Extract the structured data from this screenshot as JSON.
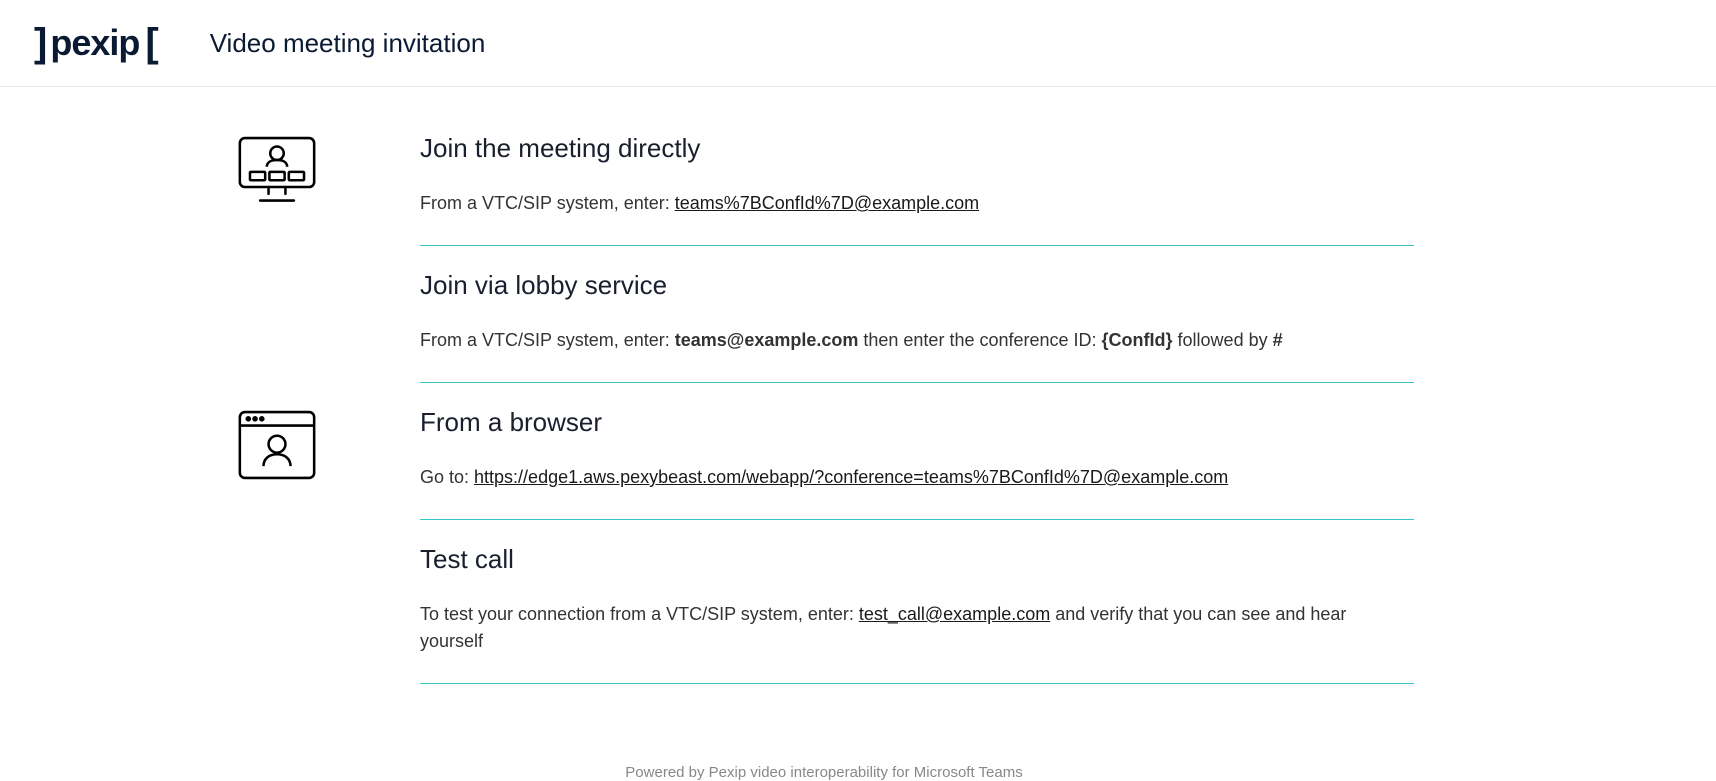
{
  "brand": "pexip",
  "page_title": "Video meeting invitation",
  "sections": {
    "direct": {
      "heading": "Join the meeting directly",
      "prefix": "From a VTC/SIP system, enter: ",
      "link": "teams%7BConfId%7D@example.com"
    },
    "lobby": {
      "heading": "Join via lobby service",
      "prefix": "From a VTC/SIP system, enter: ",
      "address": "teams@example.com",
      "mid": " then enter the conference ID: ",
      "confid": "{ConfId}",
      "mid2": " followed by ",
      "hash": "#"
    },
    "browser": {
      "heading": "From a browser",
      "prefix": "Go to: ",
      "link": "https://edge1.aws.pexybeast.com/webapp/?conference=teams%7BConfId%7D@example.com"
    },
    "test": {
      "heading": "Test call",
      "prefix": "To test your connection from a VTC/SIP system, enter: ",
      "link": "test_call@example.com",
      "suffix": " and verify that you can see and hear yourself"
    }
  },
  "footer": "Powered by Pexip video interoperability for Microsoft Teams"
}
